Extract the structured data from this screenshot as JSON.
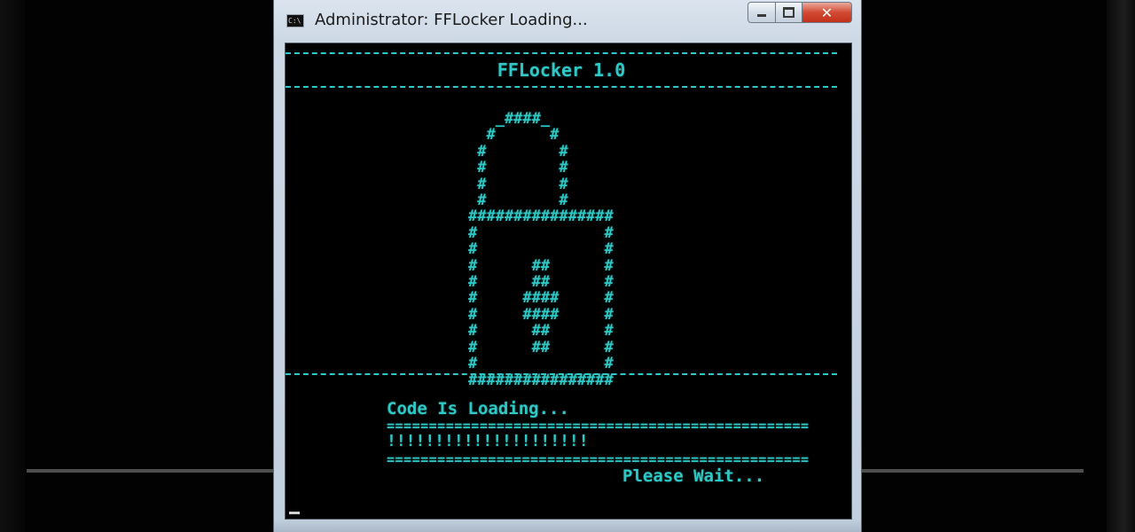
{
  "window": {
    "title": "Administrator:  FFLocker Loading...",
    "icon": "console-icon",
    "icon_text": "C:\\",
    "buttons": {
      "minimize": "minimize-icon",
      "maximize": "maximize-icon",
      "close": "close-icon",
      "close_glyph": "✕"
    }
  },
  "console": {
    "app_title": "FFLocker 1.0",
    "rule_top": "======================================================",
    "lock_art": "   _####_\n  #      #\n #        #\n #        #\n #        #\n #        #\n################\n#              #\n#              #\n#      ##      #\n#      ##      #\n#     ####     #\n#     ####     #\n#      ##      #\n#      ##      #\n#              #\n################",
    "loading_label": "Code Is Loading...",
    "progress_border": "==================================================",
    "progress_fill": "!!!!!!!!!!!!!!!!!!!!!",
    "wait_text": "Please Wait..."
  },
  "colors": {
    "terminal_text": "#2ec8c6",
    "terminal_bg": "#000000",
    "close_button": "#c9391f"
  }
}
